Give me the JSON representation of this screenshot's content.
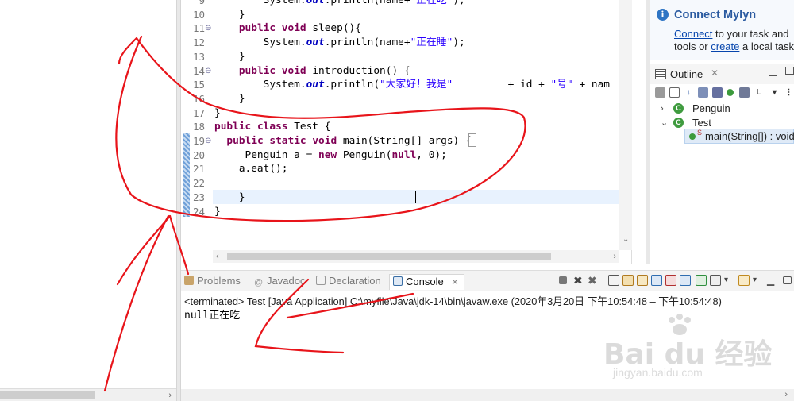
{
  "editor": {
    "lines": [
      {
        "n": "9",
        "fold": false,
        "html": "        System.<span class='out'>out</span>.println(name+<span class='str'>\"正在吃\"</span>);"
      },
      {
        "n": "10",
        "fold": false,
        "html": "    }"
      },
      {
        "n": "11",
        "fold": true,
        "html": "    <span class='kw'>public</span> <span class='kw'>void</span> sleep(){"
      },
      {
        "n": "12",
        "fold": false,
        "html": "        System.<span class='out'>out</span>.println(name+<span class='str'>\"正在睡\"</span>);"
      },
      {
        "n": "13",
        "fold": false,
        "html": "    }"
      },
      {
        "n": "14",
        "fold": true,
        "html": "    <span class='kw'>public</span> <span class='kw'>void</span> introduction() {"
      },
      {
        "n": "15",
        "fold": false,
        "html": "        System.<span class='out'>out</span>.println(<span class='str'>\"大家好！我是\"</span>         + id + <span class='str'>\"号\"</span> + nam"
      },
      {
        "n": "16",
        "fold": false,
        "html": "    }"
      },
      {
        "n": "17",
        "fold": false,
        "html": "}"
      },
      {
        "n": "18",
        "fold": false,
        "html": "<span class='kw'>public</span> <span class='kw'>class</span> Test {"
      },
      {
        "n": "19",
        "fold": true,
        "html": "  <span class='kw'>public</span> <span class='kw'>static</span> <span class='kw'>void</span> main(String[] args) {"
      },
      {
        "n": "20",
        "fold": false,
        "html": "     Penguin a = <span class='kw'>new</span> Penguin(<span class='kw'>null</span>, 0);"
      },
      {
        "n": "21",
        "fold": false,
        "html": "    a.eat();"
      },
      {
        "n": "22",
        "fold": false,
        "html": ""
      },
      {
        "n": "23",
        "fold": false,
        "html": "    }"
      },
      {
        "n": "24",
        "fold": false,
        "html": "}"
      }
    ]
  },
  "mylyn": {
    "title": "Connect Mylyn",
    "connect_link": "Connect",
    "line1_rest": " to your task and",
    "line2_pre": "tools or ",
    "create_link": "create",
    "line2_rest": " a local task"
  },
  "outline": {
    "title": "Outline",
    "close": "✕",
    "items": {
      "penguin": "Penguin",
      "test": "Test",
      "main": "main(String[]) : void"
    }
  },
  "console": {
    "tabs": {
      "problems": "Problems",
      "javadoc": "Javadoc",
      "declaration": "Declaration",
      "console": "Console",
      "close": "✕"
    },
    "status": "<terminated> Test [Java Application] C:\\myfile\\Java\\jdk-14\\bin\\javaw.exe  (2020年3月20日 下午10:54:48 – 下午10:54:48)",
    "output": "null正在吃"
  },
  "watermark": {
    "text": "Bai du 经验",
    "sub": "jingyan.baidu.com"
  },
  "colors": {
    "keyword": "#7f0055",
    "string": "#2a00ff",
    "static_field": "#0000c0",
    "annotation_red": "#e8141a"
  }
}
